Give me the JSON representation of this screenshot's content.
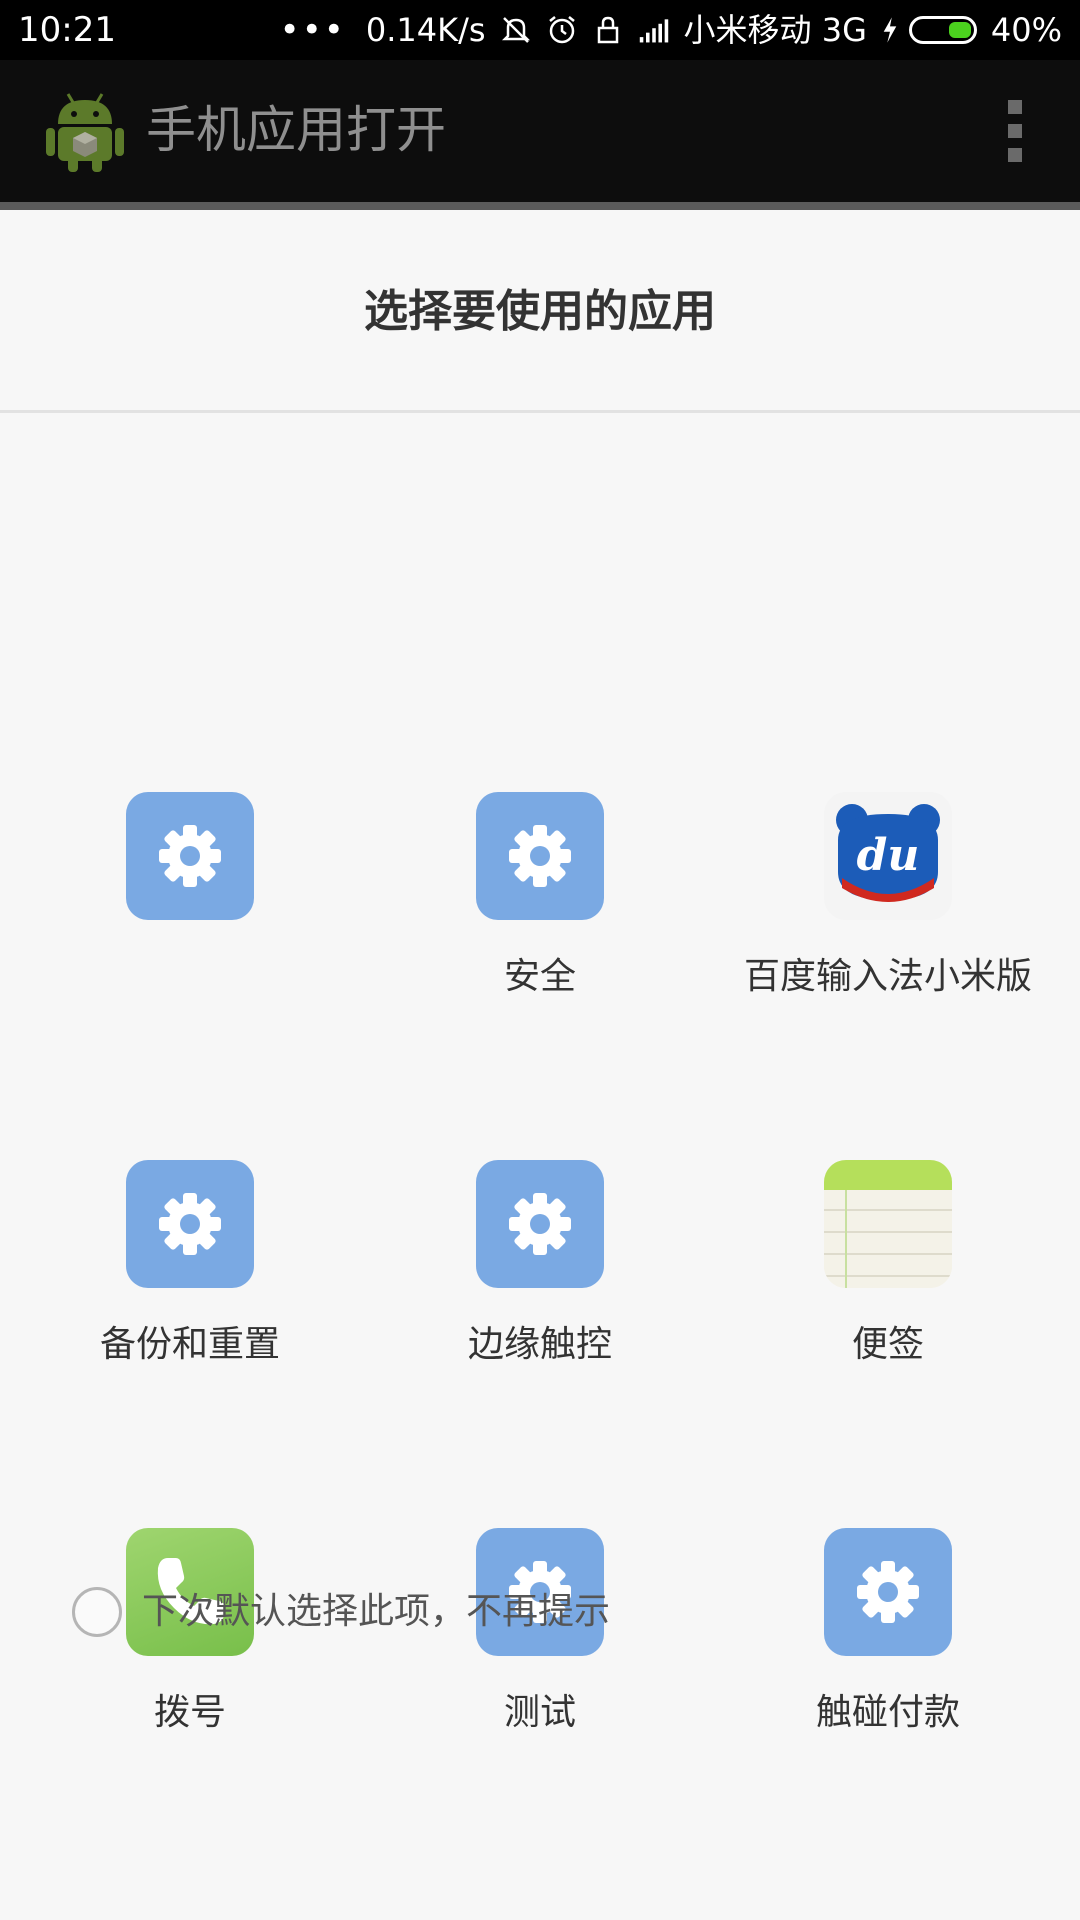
{
  "status_bar": {
    "time": "10:21",
    "dots": "•••",
    "network_speed": "0.14K/s",
    "carrier": "小米移动 3G",
    "battery_percent": "40%",
    "battery_level": 0.4,
    "icons": [
      "mute-icon",
      "alarm-icon",
      "lock-icon",
      "signal-icon",
      "charging-icon",
      "battery-icon"
    ]
  },
  "app_bar": {
    "title": "手机应用打开",
    "logo_icon": "android-icon",
    "menu_icon": "overflow-menu-icon"
  },
  "dialog": {
    "title": "选择要使用的应用",
    "apps": [
      {
        "label": "",
        "icon": "settings-gear-icon"
      },
      {
        "label": "安全",
        "icon": "settings-gear-icon"
      },
      {
        "label": "百度输入法小米版",
        "icon": "baidu-du-icon"
      },
      {
        "label": "备份和重置",
        "icon": "settings-gear-icon"
      },
      {
        "label": "边缘触控",
        "icon": "settings-gear-icon"
      },
      {
        "label": "便签",
        "icon": "notes-icon"
      },
      {
        "label": "拨号",
        "icon": "phone-icon"
      },
      {
        "label": "测试",
        "icon": "settings-gear-icon"
      },
      {
        "label": "触碰付款",
        "icon": "settings-gear-icon"
      }
    ],
    "default_checkbox_label": "下次默认选择此项，不再提示",
    "default_checkbox_checked": false
  },
  "colors": {
    "settings_icon_bg": "#7aa9e3",
    "phone_icon_bg": "#8ccb5c",
    "notes_header": "#b5df5b",
    "battery_fill": "#4bd21e"
  }
}
